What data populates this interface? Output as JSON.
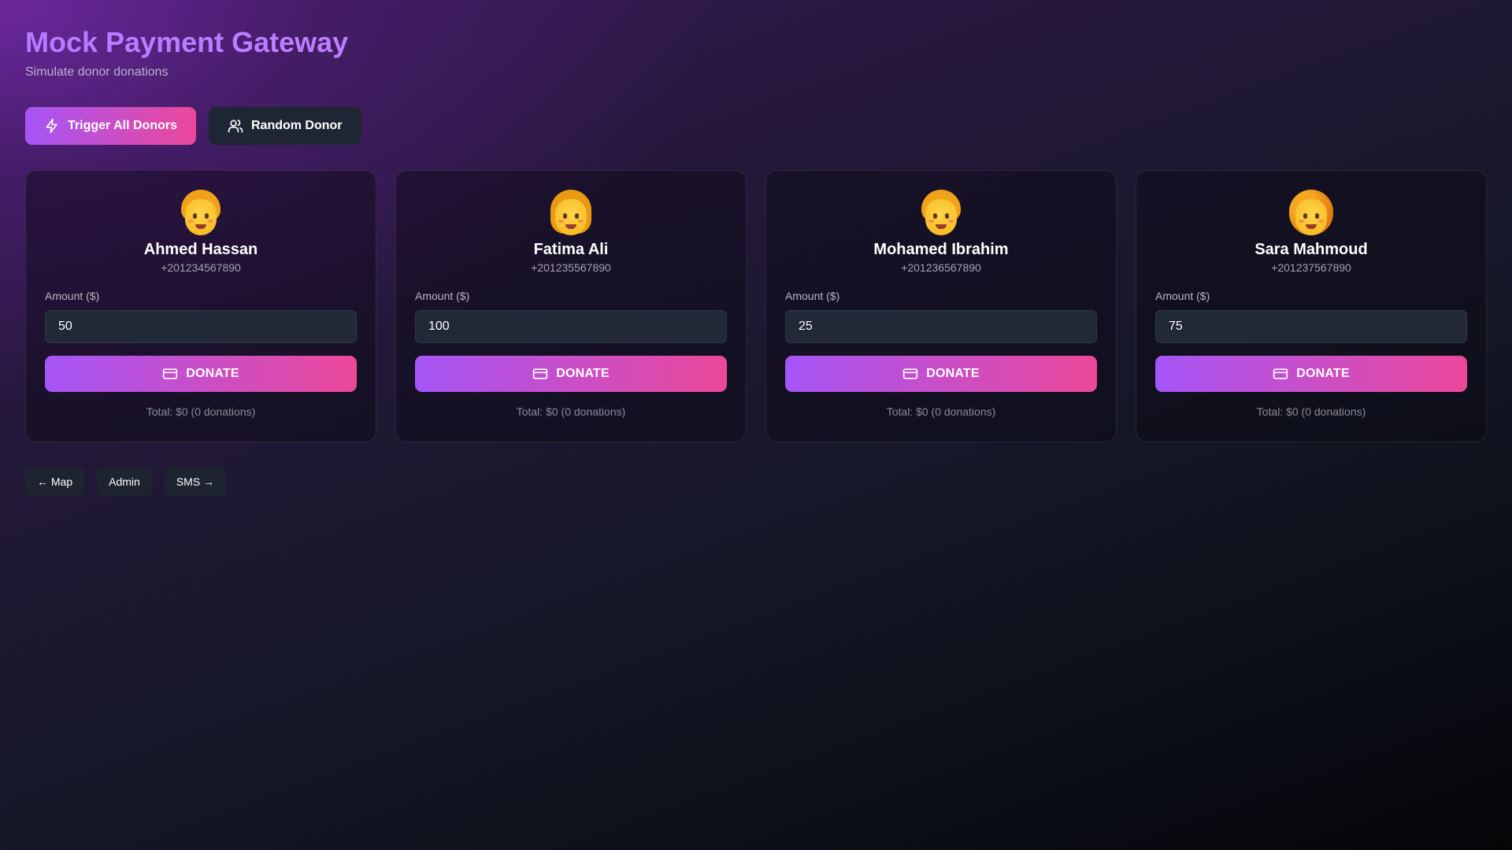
{
  "header": {
    "title": "Mock Payment Gateway",
    "subtitle": "Simulate donor donations"
  },
  "actions": {
    "trigger_all_label": "Trigger All Donors",
    "trigger_all_icon": "lightning-icon",
    "random_donor_label": "Random Donor",
    "random_donor_icon": "users-icon"
  },
  "donors": [
    {
      "name": "Ahmed Hassan",
      "phone": "+201234567890",
      "avatar": "person-emoji",
      "amount_label": "Amount ($)",
      "amount_value": "50",
      "donate_label": "DONATE",
      "donate_icon": "credit-card-icon",
      "total": "Total: $0 (0 donations)"
    },
    {
      "name": "Fatima Ali",
      "phone": "+201235567890",
      "avatar": "woman-emoji",
      "amount_label": "Amount ($)",
      "amount_value": "100",
      "donate_label": "DONATE",
      "donate_icon": "credit-card-icon",
      "total": "Total: $0 (0 donations)"
    },
    {
      "name": "Mohamed Ibrahim",
      "phone": "+201236567890",
      "avatar": "man-emoji",
      "amount_label": "Amount ($)",
      "amount_value": "25",
      "donate_label": "DONATE",
      "donate_icon": "credit-card-icon",
      "total": "Total: $0 (0 donations)"
    },
    {
      "name": "Sara Mahmoud",
      "phone": "+201237567890",
      "avatar": "curly-hair-emoji",
      "amount_label": "Amount ($)",
      "amount_value": "75",
      "donate_label": "DONATE",
      "donate_icon": "credit-card-icon",
      "total": "Total: $0 (0 donations)"
    }
  ],
  "nav": {
    "map_label": "← Map",
    "admin_label": "Admin",
    "sms_label": "SMS →"
  },
  "colors": {
    "accent_start": "#a555f7",
    "accent_end": "#ec4899",
    "title": "#c77dff",
    "dark_button": "#1e2633"
  }
}
